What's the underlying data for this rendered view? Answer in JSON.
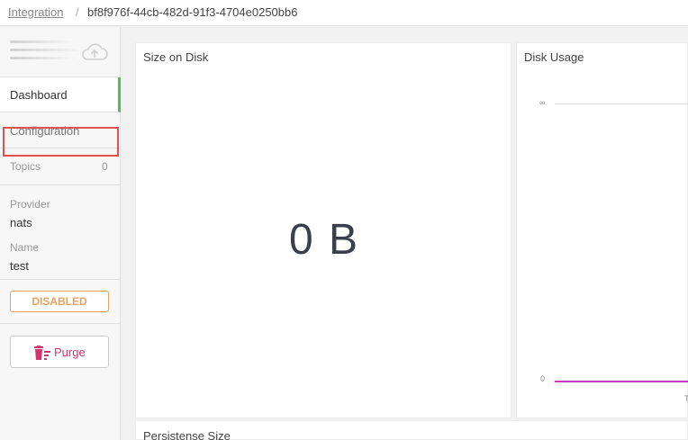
{
  "breadcrumb": {
    "parent": "Integration",
    "separator": "/",
    "current": "bf8f976f-44cb-482d-91f3-4704e0250bb6"
  },
  "sidebar": {
    "nav": [
      {
        "label": "Dashboard",
        "active": true
      },
      {
        "label": "Configuration",
        "active": false
      }
    ],
    "topics": {
      "label": "Topics",
      "count": "0"
    },
    "provider": {
      "label": "Provider",
      "value": "nats"
    },
    "name": {
      "label": "Name",
      "value": "test"
    },
    "status_badge": "DISABLED",
    "purge_label": "Purge"
  },
  "cards": {
    "size_on_disk": {
      "title": "Size on Disk",
      "value": "0 B"
    },
    "disk_usage": {
      "title": "Disk Usage",
      "y_top_tick": "∞",
      "y_bottom_tick": "0",
      "x_tick_partial": "T"
    },
    "persistence_size": {
      "title": "Persistense Size"
    }
  },
  "colors": {
    "accent_green": "#5cb85c",
    "warning_orange": "#e8a060",
    "danger_pink": "#d6336c",
    "series_magenta": "#c040c0",
    "highlight_red": "#e05252"
  }
}
